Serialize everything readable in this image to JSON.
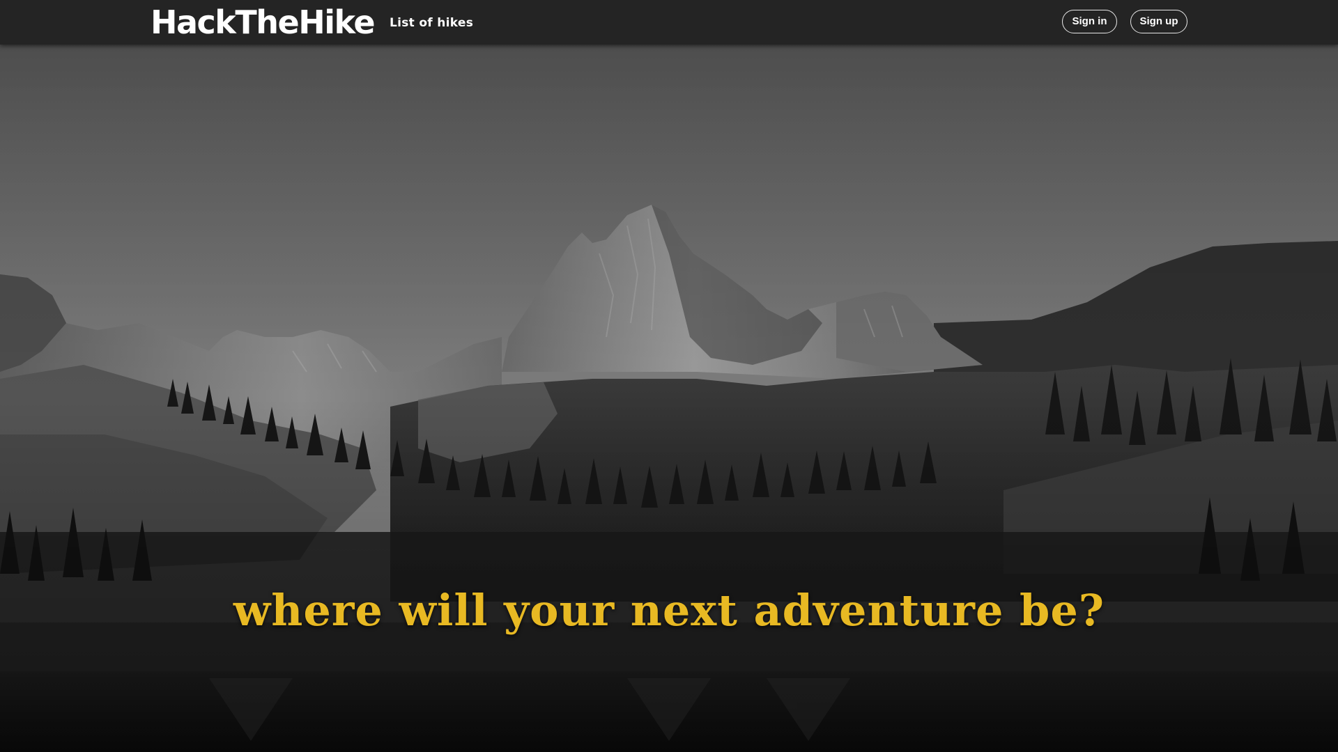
{
  "navbar": {
    "brand": "HackTheHike",
    "links": [
      "List of hikes"
    ],
    "sign_in_label": "Sign in",
    "sign_up_label": "Sign up"
  },
  "hero": {
    "tagline": "where will your next adventure be?",
    "image_description": "black-and-white mountain peak above a forested valley and lake"
  },
  "colors": {
    "navbar_bg": "#242424",
    "tagline": "#e8b923",
    "nav_text": "#ffffff"
  }
}
